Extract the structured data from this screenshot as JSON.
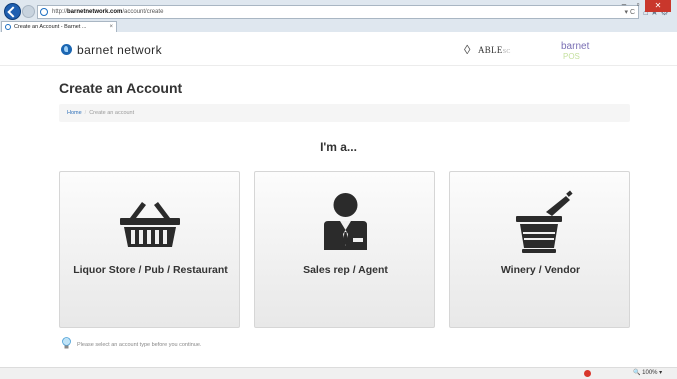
{
  "browser": {
    "url_prefix": "http://",
    "url_domain": "barnetnetwork.com",
    "url_path": "/account/create",
    "tab_title": "Create an Account - Barnet ...",
    "tab_close": "×",
    "win_min": "–",
    "win_max": "▫",
    "win_close": "✕",
    "toolbar_icons": "⌂★⚙",
    "addr_tools": "▾ C"
  },
  "header": {
    "brand": "barnet network",
    "partner1_name": "ABLE",
    "partner1_suffix": "SC",
    "partner2_name": "barnet",
    "partner2_sub": "POS"
  },
  "page": {
    "title": "Create an Account",
    "breadcrumb": {
      "home": "Home",
      "separator": "/",
      "current": "Create an account"
    },
    "prompt": "I'm a...",
    "account_types": [
      {
        "label": "Liquor Store / Pub / Restaurant",
        "icon": "shopping-basket-icon"
      },
      {
        "label": "Sales rep / Agent",
        "icon": "sales-agent-icon"
      },
      {
        "label": "Winery / Vendor",
        "icon": "wine-bucket-icon"
      }
    ],
    "hint": "Please select an account type before you continue."
  },
  "statusbar": {
    "zoom": "100%"
  },
  "colors": {
    "accent": "#3071b9",
    "icon": "#2b2b2b",
    "card_top": "#fcfcfc",
    "card_bottom": "#e8e8e8"
  }
}
